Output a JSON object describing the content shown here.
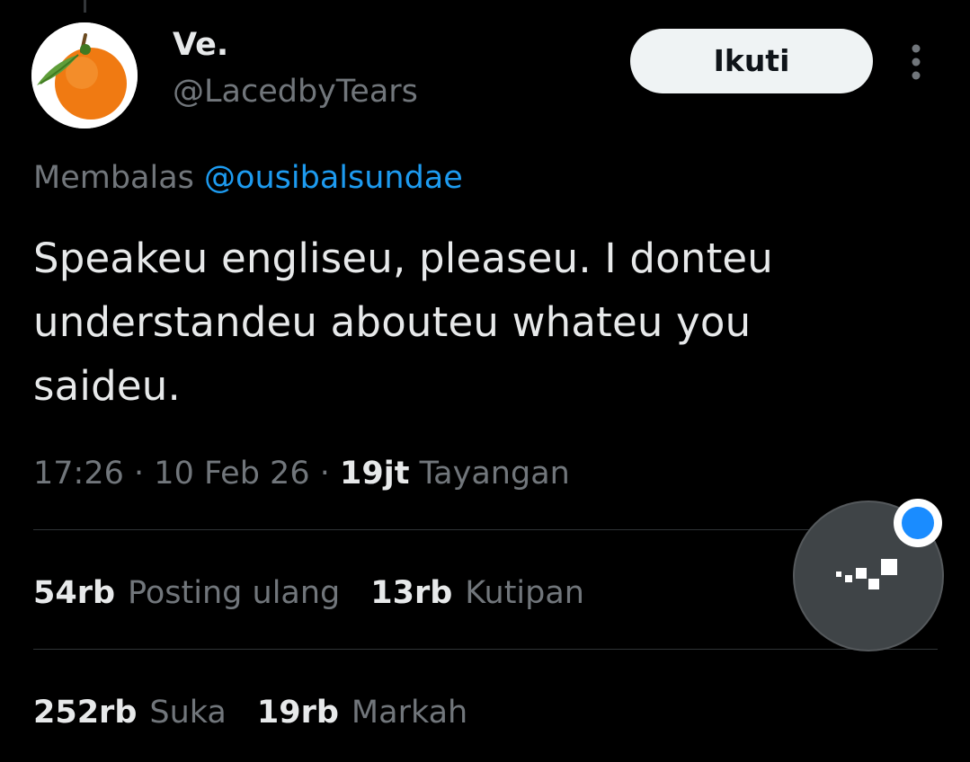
{
  "user": {
    "display_name": "Ve.",
    "handle": "@LacedbyTears",
    "avatar_icon": "orange-fruit-icon"
  },
  "follow_button_label": "Ikuti",
  "reply": {
    "prefix": "Membalas",
    "mention": "@ousibalsundae"
  },
  "tweet": {
    "text": "Speakeu engliseu, pleaseu. I donteu understandeu abouteu whateu you saideu."
  },
  "meta": {
    "time": "17:26",
    "separator": "·",
    "date": "10 Feb 26",
    "views_count": "19jt",
    "views_label": "Tayangan"
  },
  "stats": {
    "reposts": {
      "count": "54rb",
      "label": "Posting ulang"
    },
    "quotes": {
      "count": "13rb",
      "label": "Kutipan"
    },
    "likes": {
      "count": "252rb",
      "label": "Suka"
    },
    "bookmarks": {
      "count": "19rb",
      "label": "Markah"
    }
  },
  "colors": {
    "background": "#000000",
    "text_primary": "#e7e9ea",
    "text_secondary": "#71767b",
    "link": "#1d9bf0",
    "divider": "#2f3336",
    "bubble_notification": "#1a8cff"
  }
}
